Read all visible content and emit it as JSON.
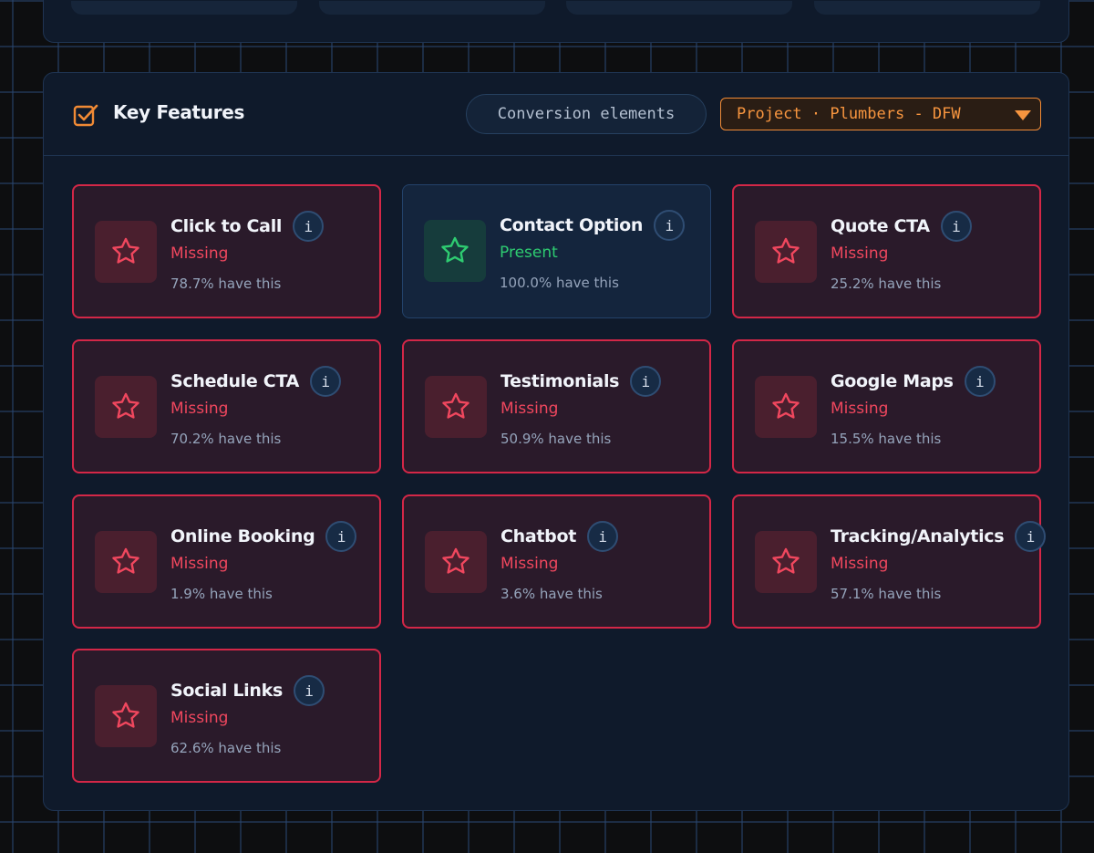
{
  "section": {
    "title": "Key Features",
    "chip_label": "Conversion elements",
    "project_select": "Project · Plumbers - DFW",
    "colors": {
      "missing": "#f0475e",
      "present": "#2ecc71",
      "accent": "#f7953f"
    }
  },
  "features": [
    {
      "name": "Click to Call",
      "status": "Missing",
      "pct_text": "78.7% have this",
      "present": false
    },
    {
      "name": "Contact Option",
      "status": "Present",
      "pct_text": "100.0% have this",
      "present": true
    },
    {
      "name": "Quote CTA",
      "status": "Missing",
      "pct_text": "25.2% have this",
      "present": false
    },
    {
      "name": "Schedule CTA",
      "status": "Missing",
      "pct_text": "70.2% have this",
      "present": false
    },
    {
      "name": "Testimonials",
      "status": "Missing",
      "pct_text": "50.9% have this",
      "present": false
    },
    {
      "name": "Google Maps",
      "status": "Missing",
      "pct_text": "15.5% have this",
      "present": false
    },
    {
      "name": "Online Booking",
      "status": "Missing",
      "pct_text": "1.9% have this",
      "present": false
    },
    {
      "name": "Chatbot",
      "status": "Missing",
      "pct_text": "3.6% have this",
      "present": false
    },
    {
      "name": "Tracking/Analytics",
      "status": "Missing",
      "pct_text": "57.1% have this",
      "present": false
    },
    {
      "name": "Social Links",
      "status": "Missing",
      "pct_text": "62.6% have this",
      "present": false
    }
  ],
  "info_glyph": "i"
}
